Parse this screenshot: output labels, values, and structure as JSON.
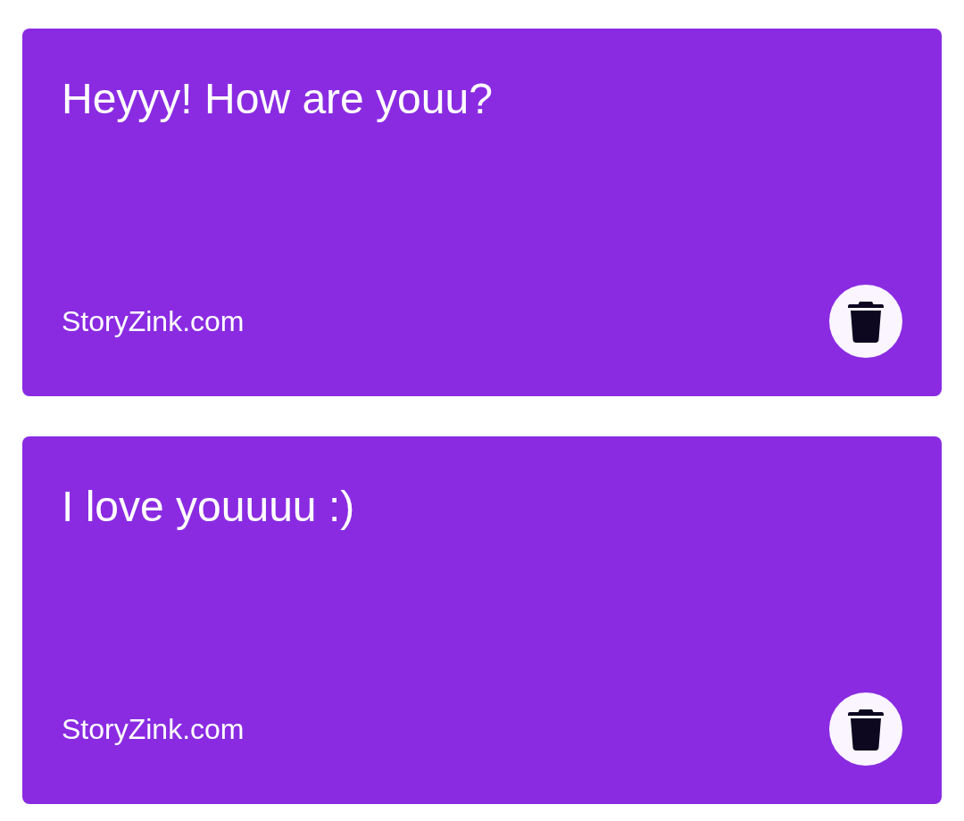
{
  "notes": [
    {
      "text": "Heyyy! How are youu?",
      "footer": "StoryZink.com"
    },
    {
      "text": "I love youuuu :)",
      "footer": "StoryZink.com"
    }
  ]
}
